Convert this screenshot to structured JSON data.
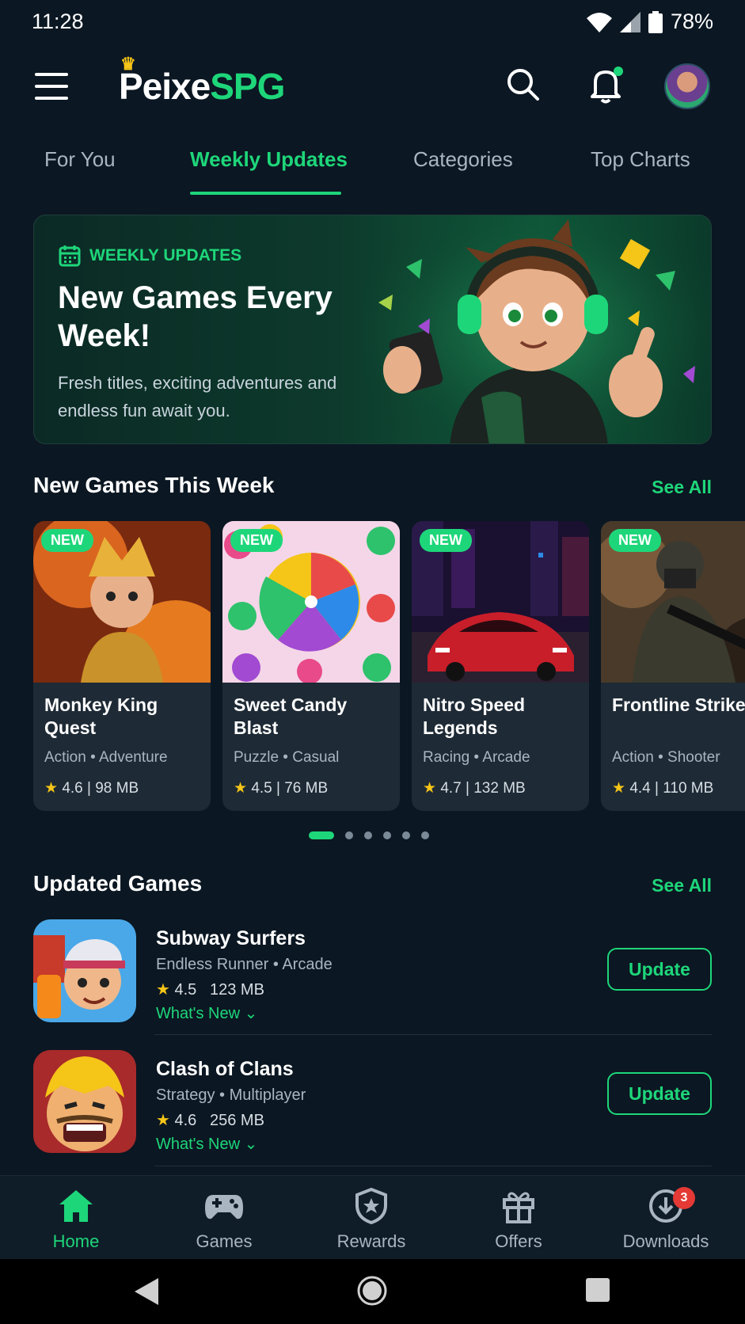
{
  "status_bar": {
    "time": "11:28",
    "battery": "78%"
  },
  "header": {
    "logo_part1": "Peixe",
    "logo_part2": "SPG"
  },
  "tabs": [
    {
      "label": "For You"
    },
    {
      "label": "Weekly Updates"
    },
    {
      "label": "Categories"
    },
    {
      "label": "Top Charts"
    }
  ],
  "hero": {
    "badge": "WEEKLY UPDATES",
    "title": "New Games Every Week!",
    "subtitle": "Fresh titles, exciting adventures and endless fun await you."
  },
  "new_games": {
    "title": "New Games This Week",
    "see_all": "See All",
    "badge": "NEW",
    "items": [
      {
        "name": "Monkey King Quest",
        "genre": "Action • Adventure",
        "meta": "4.6 | 98 MB"
      },
      {
        "name": "Sweet Candy Blast",
        "genre": "Puzzle • Casual",
        "meta": "4.5 | 76 MB"
      },
      {
        "name": "Nitro Speed Legends",
        "genre": "Racing • Arcade",
        "meta": "4.7 | 132 MB"
      },
      {
        "name": "Frontline Strike",
        "genre": "Action • Shooter",
        "meta": "4.4 | 110 MB"
      }
    ]
  },
  "updated_games": {
    "title": "Updated Games",
    "see_all": "See All",
    "items": [
      {
        "name": "Subway Surfers",
        "genre": "Endless Runner • Arcade",
        "rating": "4.5",
        "size": "123 MB",
        "whats_new": "What's New",
        "button": "Update"
      },
      {
        "name": "Clash of Clans",
        "genre": "Strategy • Multiplayer",
        "rating": "4.6",
        "size": "256 MB",
        "whats_new": "What's New",
        "button": "Update"
      }
    ]
  },
  "bottom_nav": [
    {
      "label": "Home"
    },
    {
      "label": "Games"
    },
    {
      "label": "Rewards"
    },
    {
      "label": "Offers"
    },
    {
      "label": "Downloads",
      "badge": "3"
    }
  ],
  "colors": {
    "accent": "#1ed67a",
    "background": "#0b1722",
    "star": "#f5c518"
  }
}
